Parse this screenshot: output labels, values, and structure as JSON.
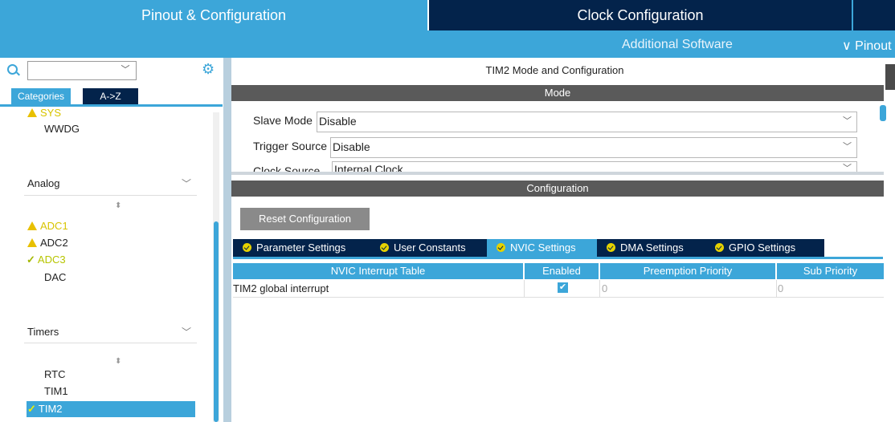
{
  "topbar": {
    "pinout_tab": "Pinout & Configuration",
    "clock_tab": "Clock Configuration",
    "additional_software": "Additional Software",
    "pinout_menu": "Pinout"
  },
  "left": {
    "search_value": "",
    "tab_categories": "Categories",
    "tab_az": "A->Z",
    "system_items": [
      "SYS",
      "WWDG"
    ],
    "analog": {
      "label": "Analog",
      "items": [
        "ADC1",
        "ADC2",
        "ADC3",
        "DAC"
      ]
    },
    "timers": {
      "label": "Timers",
      "items": [
        "RTC",
        "TIM1",
        "TIM2"
      ]
    }
  },
  "panel": {
    "title": "TIM2 Mode and Configuration",
    "mode_header": "Mode",
    "config_header": "Configuration",
    "fields": [
      {
        "label": "Slave Mode",
        "value": "Disable"
      },
      {
        "label": "Trigger Source",
        "value": "Disable"
      },
      {
        "label": "Clock Source",
        "value": "Internal Clock"
      }
    ],
    "reset_button": "Reset Configuration",
    "tabs": [
      "Parameter Settings",
      "User Constants",
      "NVIC Settings",
      "DMA Settings",
      "GPIO Settings"
    ],
    "active_tab": "NVIC Settings",
    "table": {
      "columns": [
        "NVIC Interrupt Table",
        "Enabled",
        "Preemption Priority",
        "Sub Priority"
      ],
      "rows": [
        {
          "name": "TIM2 global interrupt",
          "enabled": true,
          "preemption": "0",
          "sub": "0"
        }
      ]
    }
  },
  "colors": {
    "accent": "#3ca6d9",
    "navy": "#03234b",
    "warning": "#e8c000"
  }
}
